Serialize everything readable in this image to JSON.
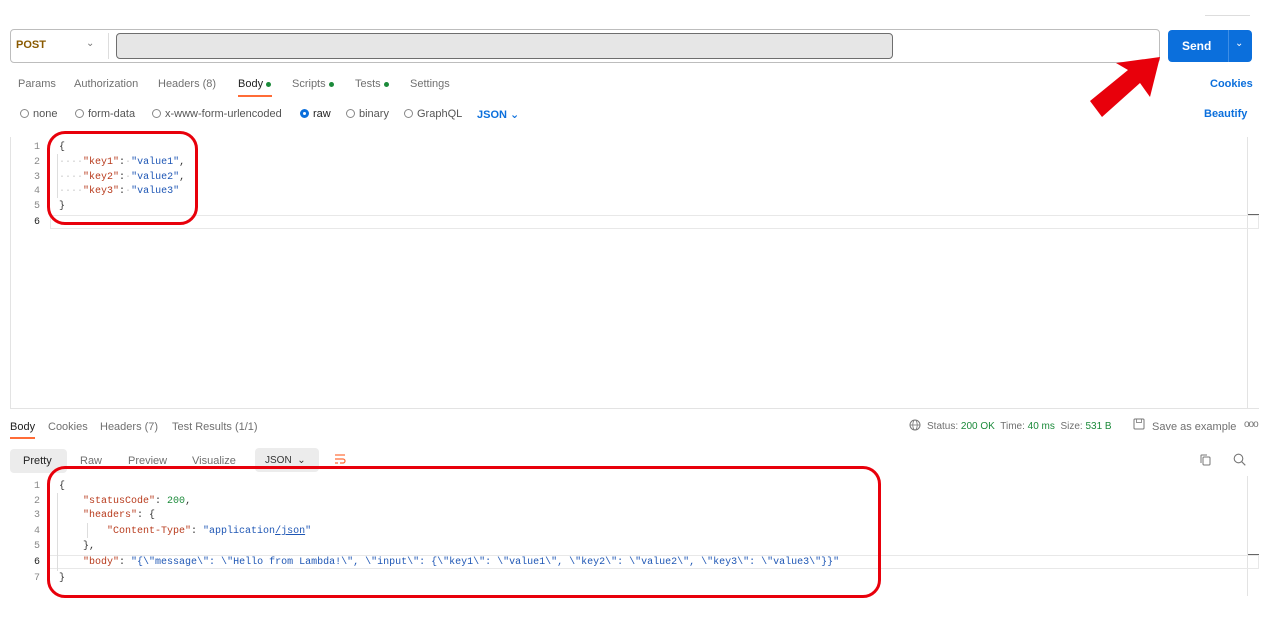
{
  "request": {
    "method": "POST",
    "url": "",
    "send_label": "Send",
    "tabs": [
      {
        "label": "Params",
        "dot": false
      },
      {
        "label": "Authorization",
        "dot": false
      },
      {
        "label": "Headers (8)",
        "dot": false
      },
      {
        "label": "Body",
        "dot": true,
        "active": true
      },
      {
        "label": "Scripts",
        "dot": true
      },
      {
        "label": "Tests",
        "dot": true
      },
      {
        "label": "Settings",
        "dot": false
      }
    ],
    "cookies_label": "Cookies",
    "body_types": [
      "none",
      "form-data",
      "x-www-form-urlencoded",
      "raw",
      "binary",
      "GraphQL"
    ],
    "selected_body_type": "raw",
    "language": "JSON",
    "beautify_label": "Beautify",
    "line_numbers": [
      "1",
      "2",
      "3",
      "4",
      "5",
      "6"
    ],
    "body_lines": {
      "open": "{",
      "key1": "\"key1\"",
      "val1": "\"value1\"",
      "key2": "\"key2\"",
      "val2": "\"value2\"",
      "key3": "\"key3\"",
      "val3": "\"value3\"",
      "close": "}"
    }
  },
  "response": {
    "tabs": [
      "Body",
      "Cookies",
      "Headers (7)",
      "Test Results (1/1)"
    ],
    "status_label": "Status:",
    "status_value": "200 OK",
    "time_label": "Time:",
    "time_value": "40 ms",
    "size_label": "Size:",
    "size_value": "531 B",
    "save_example_label": "Save as example",
    "view_tabs": [
      "Pretty",
      "Raw",
      "Preview",
      "Visualize"
    ],
    "format": "JSON",
    "line_numbers": [
      "1",
      "2",
      "3",
      "4",
      "5",
      "6",
      "7"
    ],
    "body_lines": {
      "open": "{",
      "status_key": "\"statusCode\"",
      "status_val": "200",
      "headers_key": "\"headers\"",
      "ct_key": "\"Content-Type\"",
      "ct_val_a": "\"application",
      "ct_val_b": "/json",
      "ct_val_c": "\"",
      "headers_close": "},",
      "body_key": "\"body\"",
      "body_val": "\"{\\\"message\\\": \\\"Hello from Lambda!\\\", \\\"input\\\": {\\\"key1\\\": \\\"value1\\\", \\\"key2\\\": \\\"value2\\\", \\\"key3\\\": \\\"value3\\\"}}\"",
      "close": "}"
    }
  },
  "colors": {
    "send_button": "#0b6fdc",
    "link": "#0b6fdc",
    "active_tab_underline": "#ff6c37",
    "status_ok": "#1b8a3a",
    "annotation": "#e8000b"
  },
  "icons": [
    "chevron-down-icon",
    "globe-icon",
    "save-icon",
    "more-icon",
    "wrap-lines-icon",
    "copy-icon",
    "search-icon",
    "red-arrow-annotation"
  ]
}
